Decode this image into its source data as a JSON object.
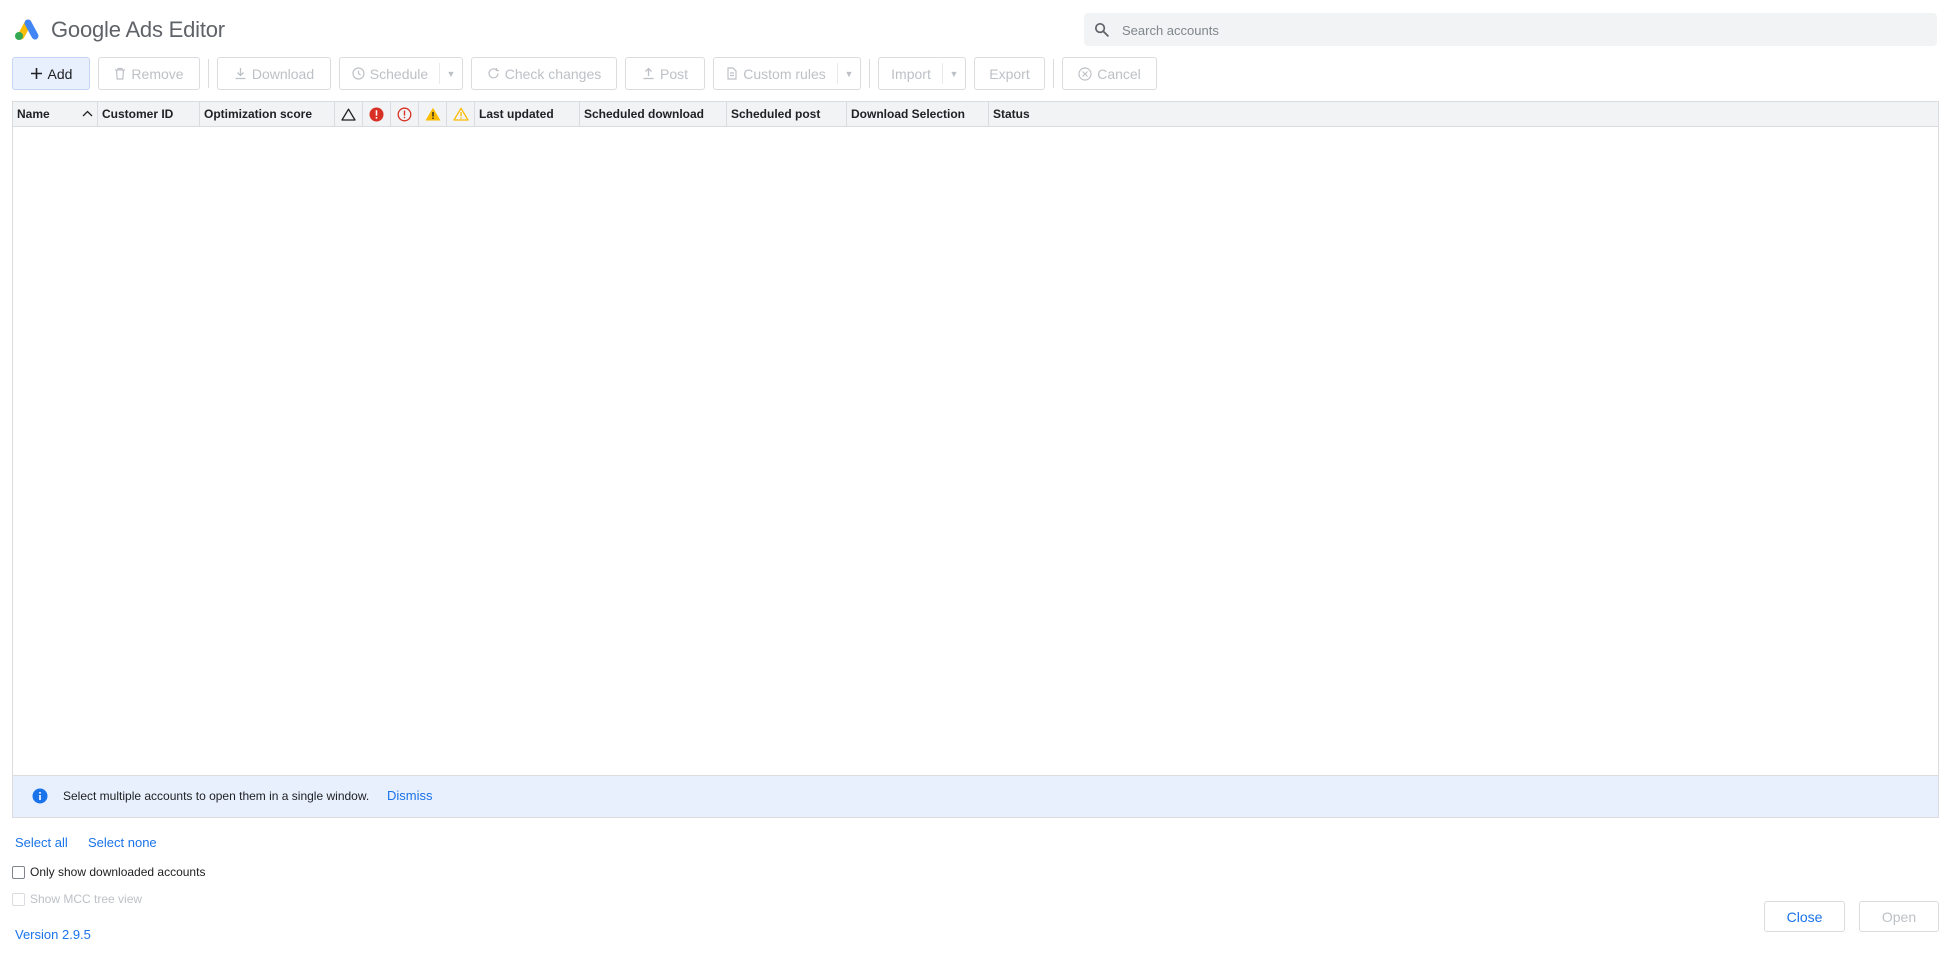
{
  "app": {
    "title": "Google Ads Editor"
  },
  "search": {
    "placeholder": "Search accounts",
    "value": ""
  },
  "toolbar": {
    "add": "Add",
    "remove": "Remove",
    "download": "Download",
    "schedule": "Schedule",
    "check_changes": "Check changes",
    "post": "Post",
    "custom_rules": "Custom rules",
    "import": "Import",
    "export": "Export",
    "cancel": "Cancel"
  },
  "table": {
    "columns": {
      "name": "Name",
      "customer_id": "Customer ID",
      "optimization_score": "Optimization score",
      "last_updated": "Last updated",
      "scheduled_download": "Scheduled download",
      "scheduled_post": "Scheduled post",
      "download_selection": "Download Selection",
      "status": "Status"
    },
    "icon_columns": [
      "warning-outline-icon",
      "error-filled-icon",
      "error-outline-icon",
      "warning-filled-icon",
      "warning-yellow-outline-icon"
    ],
    "rows": []
  },
  "info_bar": {
    "text": "Select multiple accounts to open them in a single window.",
    "dismiss": "Dismiss"
  },
  "footer": {
    "select_all": "Select all",
    "select_none": "Select none",
    "only_downloaded": "Only show downloaded accounts",
    "mcc_tree": "Show MCC tree view",
    "version": "Version 2.9.5",
    "close": "Close",
    "open": "Open"
  },
  "colors": {
    "accent": "#1a73e8",
    "error": "#d93025",
    "warning": "#fbbc04",
    "info_bg": "#e8f0fe"
  }
}
